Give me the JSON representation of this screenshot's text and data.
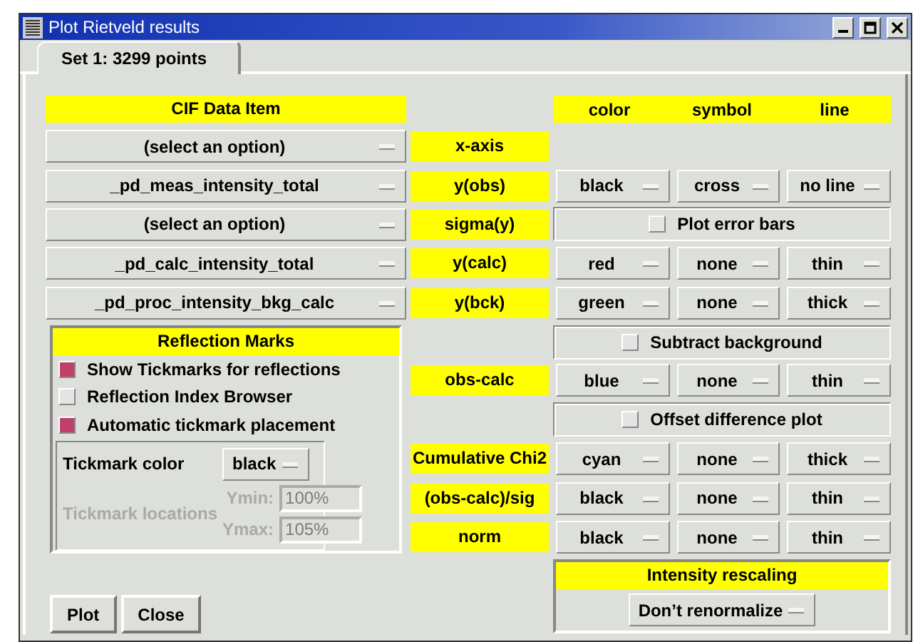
{
  "window": {
    "title": "Plot Rietveld results"
  },
  "tabs": [
    {
      "label": "Set 1: 3299 points",
      "selected": true
    }
  ],
  "cif_header": "CIF Data Item",
  "style_headers": [
    "color",
    "symbol",
    "line"
  ],
  "rows": [
    {
      "kind": "series",
      "label": "x-axis",
      "cif": "(select an option)"
    },
    {
      "kind": "series",
      "label": "y(obs)",
      "cif": "_pd_meas_intensity_total",
      "plot_color": "black",
      "symbol": "cross",
      "line": "no line"
    },
    {
      "kind": "series",
      "label": "sigma(y)",
      "cif": "(select an option)",
      "option": {
        "label": "Plot error bars",
        "checked": false
      }
    },
    {
      "kind": "series",
      "label": "y(calc)",
      "cif": "_pd_calc_intensity_total",
      "plot_color": "red",
      "symbol": "none",
      "line": "thin"
    },
    {
      "kind": "series",
      "label": "y(bck)",
      "cif": "_pd_proc_intensity_bkg_calc",
      "plot_color": "green",
      "symbol": "none",
      "line": "thick"
    },
    {
      "kind": "option",
      "label": "Subtract background",
      "checked": false
    },
    {
      "kind": "series",
      "label": "obs-calc",
      "plot_color": "blue",
      "symbol": "none",
      "line": "thin"
    },
    {
      "kind": "option",
      "label": "Offset difference plot",
      "checked": false
    },
    {
      "kind": "series",
      "label": "Cumulative Chi2",
      "plot_color": "cyan",
      "symbol": "none",
      "line": "thick"
    },
    {
      "kind": "series",
      "label": "(obs-calc)/sig",
      "plot_color": "black",
      "symbol": "none",
      "line": "thin"
    },
    {
      "kind": "series",
      "label": "norm",
      "plot_color": "black",
      "symbol": "none",
      "line": "thin"
    }
  ],
  "reflection_marks": {
    "title": "Reflection Marks",
    "options": [
      {
        "label": "Show Tickmarks for reflections",
        "checked": true
      },
      {
        "label": "Reflection Index Browser",
        "checked": false
      },
      {
        "label": "Automatic tickmark placement",
        "checked": true
      }
    ],
    "tickmark_color": {
      "label": "Tickmark color",
      "value": "black"
    },
    "tickmark_locations": {
      "label": "Tickmark locations",
      "disabled": true,
      "ymin_label": "Ymin:",
      "ymin": "100%",
      "ymax_label": "Ymax:",
      "ymax": "105%"
    }
  },
  "buttons": [
    "Plot",
    "Close"
  ],
  "intensity_rescaling": {
    "title": "Intensity rescaling",
    "value": "Don’t renormalize"
  }
}
